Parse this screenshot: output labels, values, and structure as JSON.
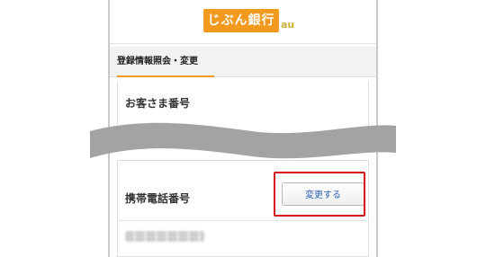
{
  "header": {
    "logo_text": "じぶん銀行",
    "logo_mark": "au"
  },
  "section": {
    "title": "登録情報照会・変更"
  },
  "customer_number": {
    "label": "お客さま番号"
  },
  "mobile_phone": {
    "label": "携帯電話番号",
    "change_button": "変更する"
  },
  "colors": {
    "brand_orange": "#f39a1e",
    "highlight_red": "#d4141c",
    "button_text_blue": "#2a5fb0",
    "wave_gray": "#a3a3a3"
  }
}
